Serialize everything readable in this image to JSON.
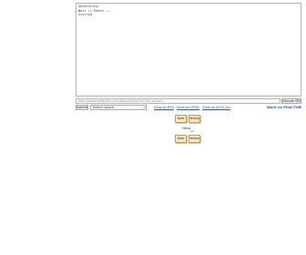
{
  "output": {
    "lines": [
      "Generating",
      "Wait => Match ...",
      "Started"
    ]
  },
  "url_bar": {
    "value": "http://www.mafia-like.com/Ajaxcall.php?url=fb_action=...",
    "decode_label": "Decode URL"
  },
  "controls": {
    "submit_label": "Submit",
    "layout_select": "Switch layout"
  },
  "links": {
    "view_items": [
      "View as RSS",
      "View as HTML",
      "View as ASCII Art"
    ],
    "work_label": "Work as Pilot FOB"
  },
  "tiles": {
    "top": [
      "Kale",
      "Yellow"
    ],
    "middle_label": "Hello",
    "middle_sub": "xa",
    "bottom": [
      "Kale",
      "Yellow"
    ]
  }
}
